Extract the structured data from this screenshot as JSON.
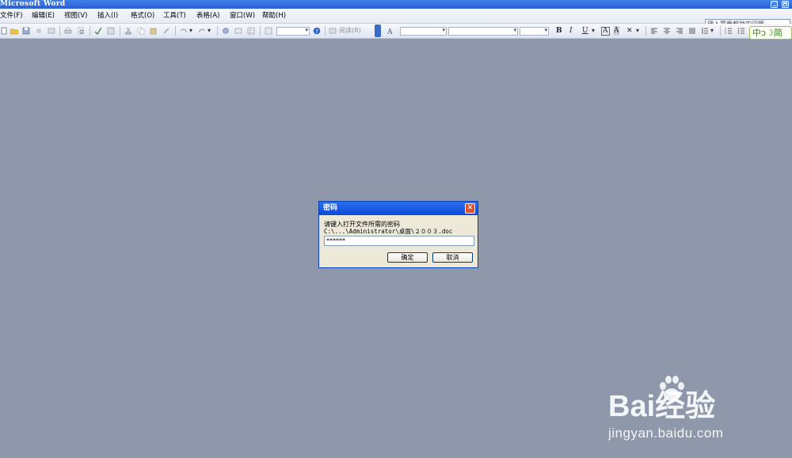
{
  "window": {
    "title": "Microsoft Word"
  },
  "menubar": {
    "items": [
      "文件(F)",
      "编辑(E)",
      "视图(V)",
      "插入(I)",
      "格式(O)",
      "工具(T)",
      "表格(A)",
      "窗口(W)",
      "帮助(H)"
    ]
  },
  "help_box": {
    "placeholder": "键入需要帮助的问题"
  },
  "toolbar": {
    "reading_label": "阅读(R)"
  },
  "ime": {
    "label": "中ↄ☽简"
  },
  "dialog": {
    "title": "密码",
    "prompt": "请键入打开文件所需的密码",
    "file_path": "C:\\...\\Administrator\\桌面\\２００３.doc",
    "password_value": "******",
    "ok_label": "确定",
    "cancel_label": "取消"
  },
  "watermark": {
    "brand": "Bai经验",
    "url": "jingyan.baidu.com"
  },
  "colors": {
    "workspace": "#8e98aa",
    "titlebar": "#2a5fd4",
    "dialog_bg": "#ece9d8"
  }
}
